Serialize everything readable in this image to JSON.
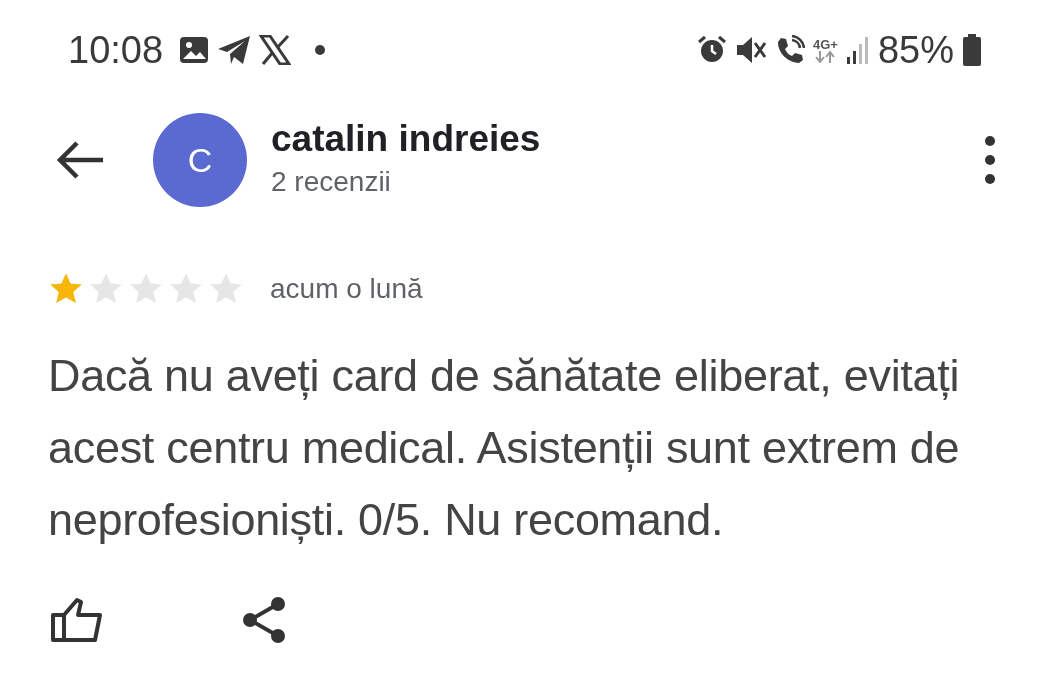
{
  "status_bar": {
    "time": "10:08",
    "network": "4G+",
    "battery": "85%"
  },
  "header": {
    "avatar_letter": "C",
    "name": "catalin indreies",
    "subtitle": "2 recenzii"
  },
  "review": {
    "stars": 1,
    "date": "acum o lună",
    "text": "Dacă nu aveți card de sănătate eliberat, evitați acest centru medical. Asistenții sunt extrem de neprofesioniști. 0/5. Nu recomand."
  }
}
